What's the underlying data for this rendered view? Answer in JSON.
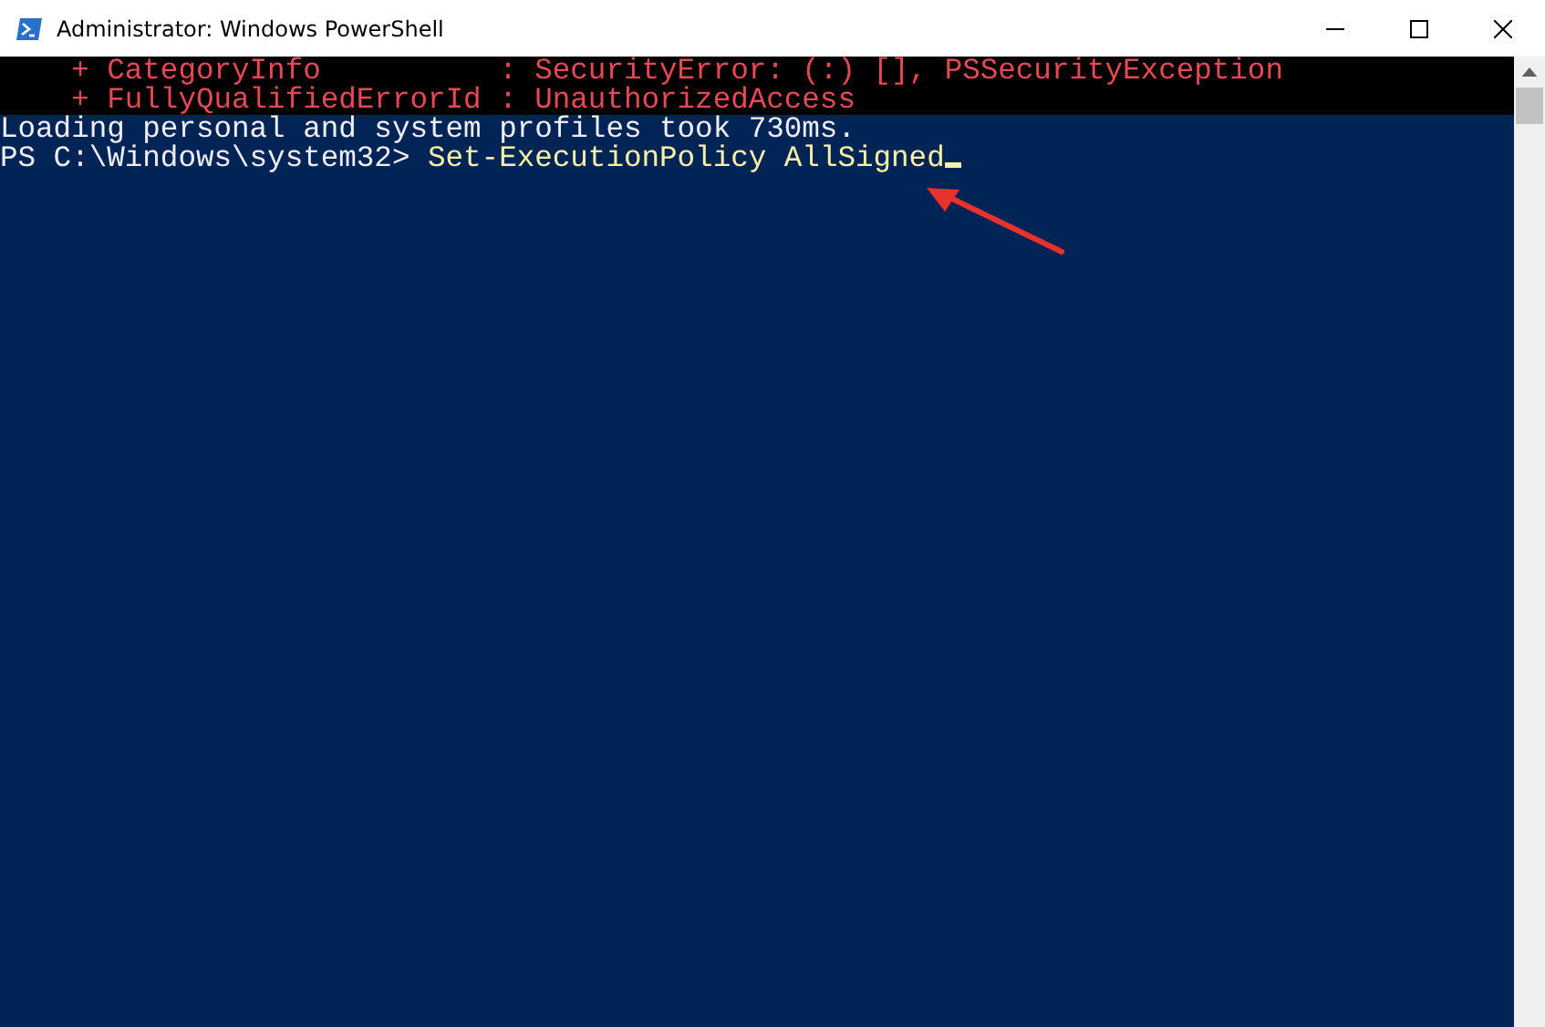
{
  "window": {
    "title": "Administrator: Windows PowerShell"
  },
  "lines": [
    {
      "kind": "error",
      "text": "    + CategoryInfo          : SecurityError: (:) [], PSSecurityException"
    },
    {
      "kind": "error",
      "text": "    + FullyQualifiedErrorId : UnauthorizedAccess"
    },
    {
      "kind": "output",
      "text": "Loading personal and system profiles took 730ms."
    },
    {
      "kind": "prompt",
      "prompt": "PS C:\\Windows\\system32> ",
      "command": "Set-ExecutionPolicy AllSigned"
    }
  ]
}
